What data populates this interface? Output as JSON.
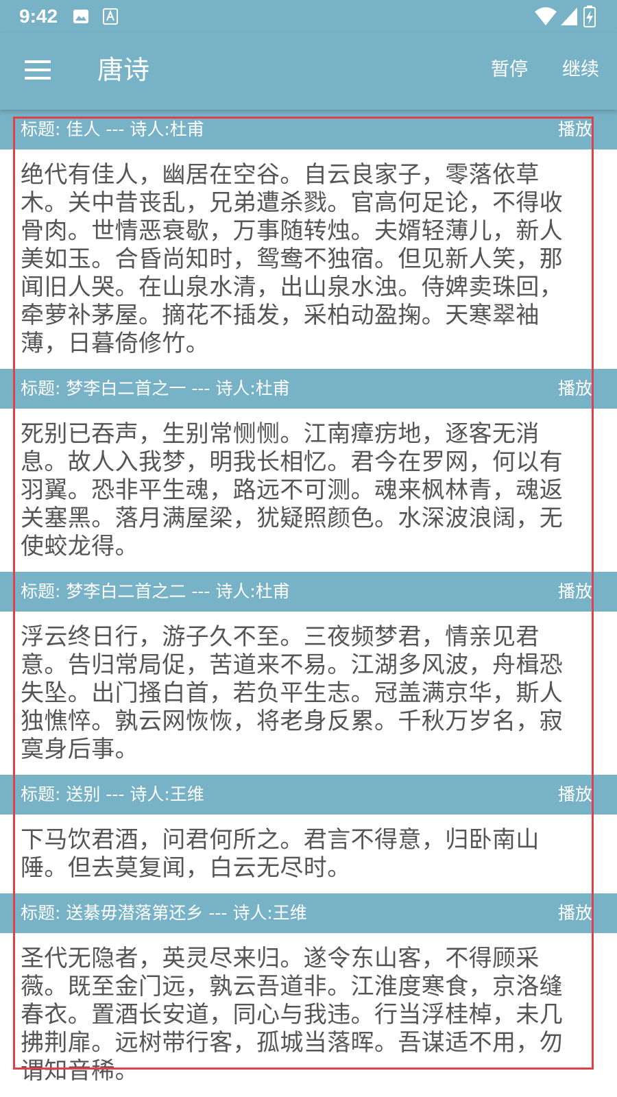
{
  "status_bar": {
    "time": "9:42",
    "icons": [
      "image-icon",
      "font-download-icon",
      "wifi-icon",
      "signal-icon",
      "battery-icon"
    ]
  },
  "app_bar": {
    "title": "唐诗",
    "menu_icon": "menu-icon",
    "actions": {
      "pause": "暂停",
      "resume": "继续"
    }
  },
  "colors": {
    "accent": "#78b2c6",
    "body_text": "#555555",
    "highlight": "#e0404a"
  },
  "poems": [
    {
      "header": "标题: 佳人 --- 诗人:杜甫",
      "play": "播放",
      "text": "绝代有佳人，幽居在空谷。自云良家子，零落依草木。关中昔丧乱，兄弟遭杀戮。官高何足论，不得收骨肉。世情恶衰歇，万事随转烛。夫婿轻薄儿，新人美如玉。合昏尚知时，鸳鸯不独宿。但见新人笑，那闻旧人哭。在山泉水清，出山泉水浊。侍婢卖珠回，牵萝补茅屋。摘花不插发，采柏动盈掬。天寒翠袖薄，日暮倚修竹。"
    },
    {
      "header": "标题: 梦李白二首之一 --- 诗人:杜甫",
      "play": "播放",
      "text": "死别已吞声，生别常恻恻。江南瘴疠地，逐客无消息。故人入我梦，明我长相忆。君今在罗网，何以有羽翼。恐非平生魂，路远不可测。魂来枫林青，魂返关塞黑。落月满屋梁，犹疑照颜色。水深波浪阔，无使蛟龙得。"
    },
    {
      "header": "标题: 梦李白二首之二 --- 诗人:杜甫",
      "play": "播放",
      "text": "浮云终日行，游子久不至。三夜频梦君，情亲见君意。告归常局促，苦道来不易。江湖多风波，舟楫恐失坠。出门搔白首，若负平生志。冠盖满京华，斯人独憔悴。孰云网恢恢，将老身反累。千秋万岁名，寂寞身后事。"
    },
    {
      "header": "标题: 送别 --- 诗人:王维",
      "play": "播放",
      "text": "下马饮君酒，问君何所之。君言不得意，归卧南山陲。但去莫复闻，白云无尽时。"
    },
    {
      "header": "标题: 送綦毋潜落第还乡 --- 诗人:王维",
      "play": "播放",
      "text": "圣代无隐者，英灵尽来归。遂令东山客，不得顾采薇。既至金门远，孰云吾道非。江淮度寒食，京洛缝春衣。置酒长安道，同心与我违。行当浮桂棹，未几拂荆扉。远树带行客，孤城当落晖。吾谋适不用，勿谓知音稀。"
    }
  ]
}
